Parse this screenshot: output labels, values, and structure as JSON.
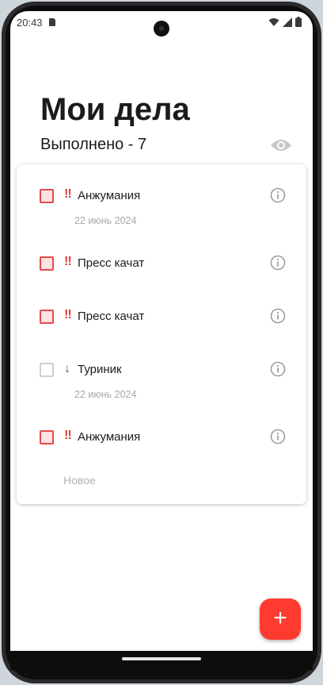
{
  "status_bar": {
    "time": "20:43"
  },
  "header": {
    "title": "Мои дела",
    "done_label": "Выполнено - 7"
  },
  "tasks": [
    {
      "priority": "‼",
      "text": "Анжумания",
      "date": "22 июнь 2024"
    },
    {
      "priority": "‼",
      "text": "Пресс качат",
      "date": ""
    },
    {
      "priority": "‼",
      "text": "Пресс качат",
      "date": ""
    },
    {
      "priority": "↓",
      "text": "Туриник",
      "date": "22 июнь 2024"
    },
    {
      "priority": "‼",
      "text": "Анжумания",
      "date": ""
    }
  ],
  "new_item_placeholder": "Новое",
  "fab": {
    "label": "+"
  },
  "colors": {
    "accent": "#ff3b30",
    "high_priority": "#e53935"
  },
  "icons": [
    "wifi-icon",
    "signal-icon",
    "battery-icon",
    "eye-icon",
    "info-icon",
    "plus-icon"
  ]
}
